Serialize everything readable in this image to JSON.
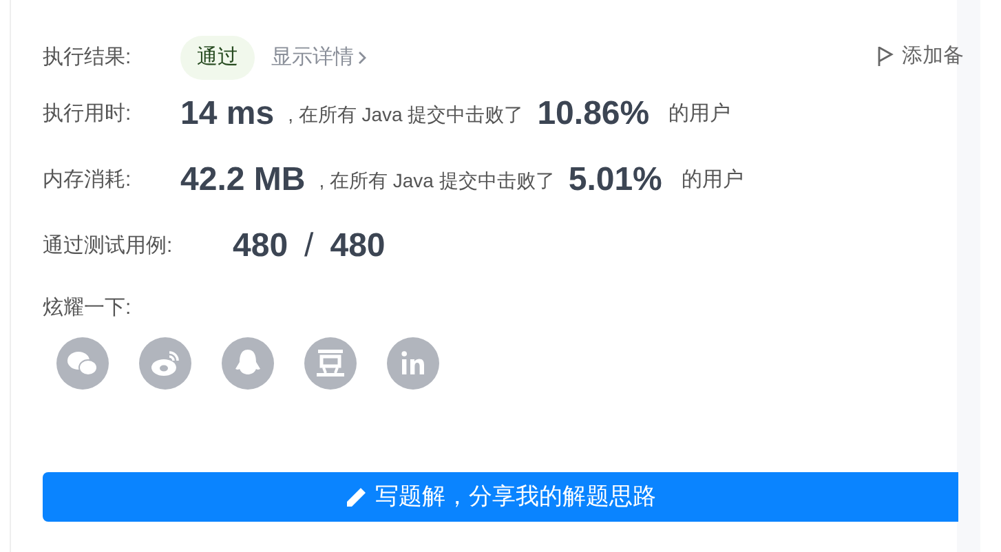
{
  "result": {
    "label": "执行结果:",
    "status": "通过",
    "details_link": "显示详情",
    "note_button": "添加备"
  },
  "stats": [
    {
      "label": "执行用时:",
      "value": "14 ms",
      "text": ", 在所有 Java 提交中击败了",
      "percent": "10.86%",
      "suffix": "的用户"
    },
    {
      "label": "内存消耗:",
      "value": "42.2 MB",
      "text": ", 在所有 Java 提交中击败了",
      "percent": "5.01%",
      "suffix": "的用户"
    }
  ],
  "tests": {
    "label": "通过测试用例:",
    "passed": "480",
    "separator": "/",
    "total": "480"
  },
  "share": {
    "label": "炫耀一下:",
    "targets": [
      {
        "kind": "wechat"
      },
      {
        "kind": "weibo"
      },
      {
        "kind": "qq"
      },
      {
        "kind": "douban"
      },
      {
        "kind": "linkedin"
      }
    ]
  },
  "solution_button": "写题解，分享我的解题思路"
}
